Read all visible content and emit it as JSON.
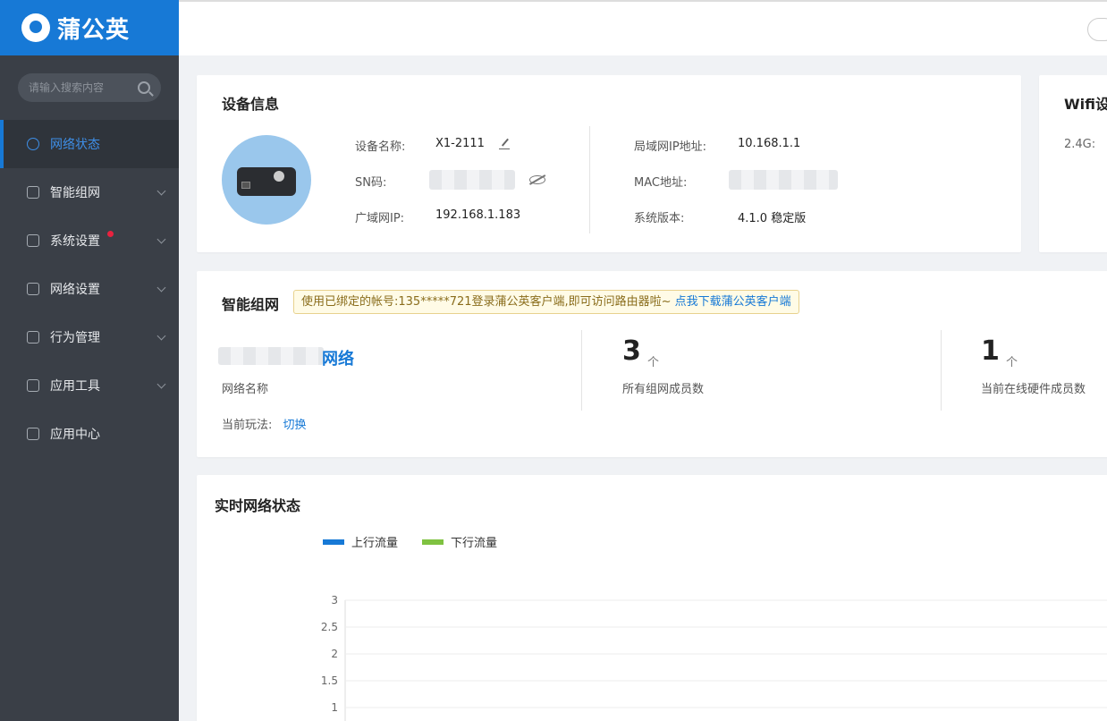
{
  "brand": {
    "name": "蒲公英"
  },
  "sidebar": {
    "search_placeholder": "请输入搜索内容",
    "items": [
      {
        "label": "网络状态",
        "active": true
      },
      {
        "label": "智能组网"
      },
      {
        "label": "系统设置",
        "badge": true
      },
      {
        "label": "网络设置"
      },
      {
        "label": "行为管理"
      },
      {
        "label": "应用工具"
      },
      {
        "label": "应用中心"
      }
    ]
  },
  "device": {
    "title": "设备信息",
    "name_label": "设备名称:",
    "name_value": "X1-2111",
    "sn_label": "SN码:",
    "wan_label": "广域网IP:",
    "wan_value": "192.168.1.183",
    "lan_label": "局域网IP地址:",
    "lan_value": "10.168.1.1",
    "mac_label": "MAC地址:",
    "version_label": "系统版本:",
    "version_value": "4.1.0 稳定版"
  },
  "wifi": {
    "title": "Wifi设",
    "band_label": "2.4G:"
  },
  "mesh": {
    "title": "智能组网",
    "notice_text": "使用已绑定的帐号:135*****721登录蒲公英客户端,即可访问路由器啦~ ",
    "notice_link": "点我下载蒲公英客户端",
    "network_name_suffix": "网络",
    "network_name_label": "网络名称",
    "mode_label": "当前玩法:",
    "mode_link": "切换",
    "members_count": "3",
    "members_unit": "个",
    "members_label": "所有组网成员数",
    "online_count": "1",
    "online_unit": "个",
    "online_label": "当前在线硬件成员数"
  },
  "realtime": {
    "title": "实时网络状态"
  },
  "chart_data": {
    "type": "line",
    "series": [
      {
        "name": "上行流量",
        "color": "#1779d6",
        "values": []
      },
      {
        "name": "下行流量",
        "color": "#7fc241",
        "values": []
      }
    ],
    "yticks": [
      "3",
      "2.5",
      "2",
      "1.5",
      "1"
    ],
    "ylim": [
      1,
      3
    ],
    "grid": true,
    "legend": "top-left"
  }
}
